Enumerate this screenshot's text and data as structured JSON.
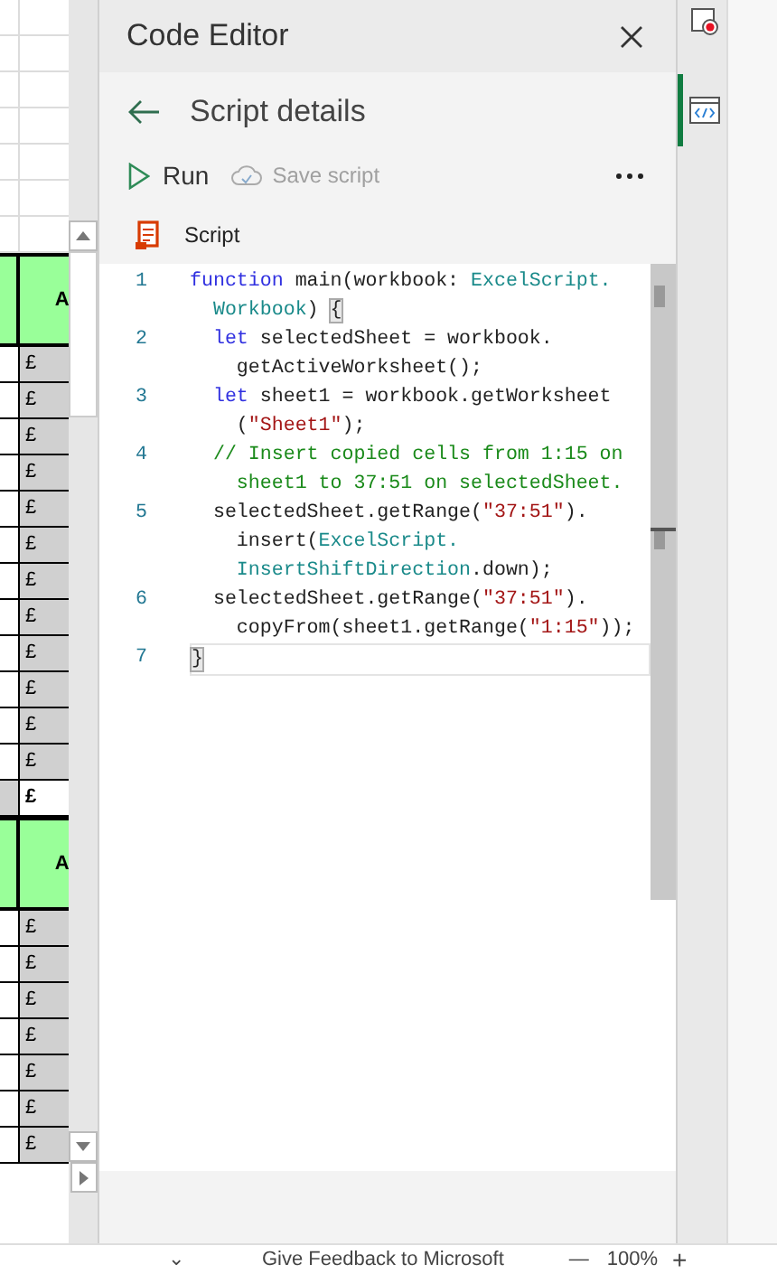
{
  "sheet": {
    "sections": [
      {
        "header": "A",
        "cells": [
          {
            "text": "£",
            "bold": false
          },
          {
            "text": "£",
            "bold": false
          },
          {
            "text": "£",
            "bold": false
          },
          {
            "text": "£",
            "bold": false
          },
          {
            "text": "£",
            "bold": false
          },
          {
            "text": "£",
            "bold": false
          },
          {
            "text": "£",
            "bold": false
          },
          {
            "text": "£",
            "bold": false
          },
          {
            "text": "£",
            "bold": false
          },
          {
            "text": "£",
            "bold": false
          },
          {
            "text": "£",
            "bold": false
          },
          {
            "text": "£",
            "bold": false
          },
          {
            "text": "£",
            "bold": true
          }
        ]
      },
      {
        "header": "A",
        "cells": [
          {
            "text": "£",
            "bold": false
          },
          {
            "text": "£",
            "bold": false
          },
          {
            "text": "£",
            "bold": false
          },
          {
            "text": "£",
            "bold": false
          },
          {
            "text": "£",
            "bold": false
          },
          {
            "text": "£",
            "bold": false
          },
          {
            "text": "£",
            "bold": false
          }
        ]
      }
    ]
  },
  "panel": {
    "title": "Code Editor",
    "subtitle": "Script details",
    "run": "Run",
    "save": {
      "label": "Save script",
      "disabled": true
    },
    "script_label": "Script"
  },
  "code": [
    {
      "number": "1",
      "lines": [
        [
          {
            "text": "function ",
            "kind": "keyword"
          },
          {
            "text": "main(workbook: ",
            "kind": "plain"
          },
          {
            "text": "ExcelScript.",
            "kind": "type"
          }
        ],
        [
          {
            "text": "  Workbook",
            "kind": "type"
          },
          {
            "text": ") ",
            "kind": "plain"
          },
          {
            "text": "{",
            "kind": "bracket"
          }
        ]
      ]
    },
    {
      "number": "2",
      "lines": [
        [
          {
            "text": "  let ",
            "kind": "keyword"
          },
          {
            "text": "selectedSheet = workbook.",
            "kind": "plain"
          }
        ],
        [
          {
            "text": "    getActiveWorksheet();",
            "kind": "plain"
          }
        ]
      ]
    },
    {
      "number": "3",
      "lines": [
        [
          {
            "text": "  let ",
            "kind": "keyword"
          },
          {
            "text": "sheet1 = workbook.getWorksheet",
            "kind": "plain"
          }
        ],
        [
          {
            "text": "    (",
            "kind": "plain"
          },
          {
            "text": "\"Sheet1\"",
            "kind": "string"
          },
          {
            "text": ");",
            "kind": "plain"
          }
        ]
      ]
    },
    {
      "number": "4",
      "lines": [
        [
          {
            "text": "  // Insert copied cells from 1:15 on",
            "kind": "comment"
          }
        ],
        [
          {
            "text": "    sheet1 to 37:51 on selectedSheet.",
            "kind": "comment"
          }
        ]
      ]
    },
    {
      "number": "5",
      "lines": [
        [
          {
            "text": "  selectedSheet.getRange(",
            "kind": "plain"
          },
          {
            "text": "\"37:51\"",
            "kind": "string"
          },
          {
            "text": ").",
            "kind": "plain"
          }
        ],
        [
          {
            "text": "    insert(",
            "kind": "plain"
          },
          {
            "text": "ExcelScript.",
            "kind": "type"
          }
        ],
        [
          {
            "text": "    InsertShiftDirection",
            "kind": "type"
          },
          {
            "text": ".down);",
            "kind": "plain"
          }
        ]
      ]
    },
    {
      "number": "6",
      "lines": [
        [
          {
            "text": "  selectedSheet.getRange(",
            "kind": "plain"
          },
          {
            "text": "\"37:51\"",
            "kind": "string"
          },
          {
            "text": ").",
            "kind": "plain"
          }
        ],
        [
          {
            "text": "    copyFrom(sheet1.getRange(",
            "kind": "plain"
          },
          {
            "text": "\"1:15\"",
            "kind": "string"
          },
          {
            "text": "));",
            "kind": "plain"
          }
        ]
      ]
    },
    {
      "number": "7",
      "lines": [
        [
          {
            "text": "}",
            "kind": "bracket"
          }
        ]
      ]
    }
  ],
  "rail": [
    {
      "kind": "recorder",
      "selected": false
    },
    {
      "kind": "code",
      "selected": true
    }
  ],
  "status_bar": {
    "menu": "⌄",
    "feedback": "Give Feedback to Microsoft",
    "zoom_out": "—",
    "zoom": "100%",
    "zoom_in": "+"
  }
}
